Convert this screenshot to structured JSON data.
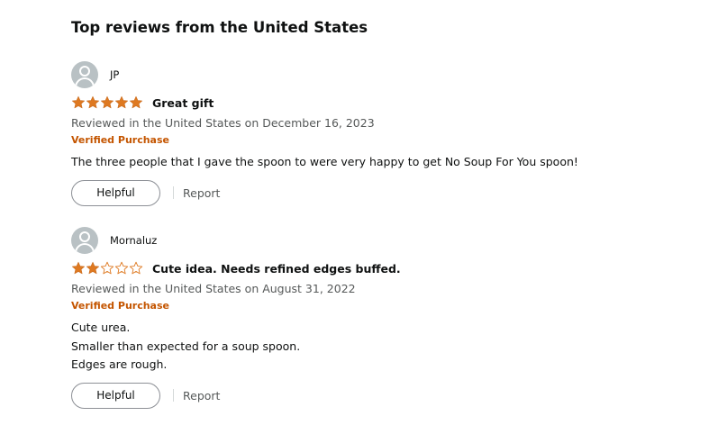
{
  "section_title": "Top reviews from the United States",
  "colors": {
    "star_fill": "#de7921",
    "star_empty_stroke": "#de7921",
    "verified": "#c45500",
    "avatar_bg": "#b9c1c4"
  },
  "reviews": [
    {
      "profile_name": "JP",
      "avatar_icon": "default-user-avatar-icon",
      "rating": 5,
      "rating_max": 5,
      "title": "Great gift",
      "date": "Reviewed in the United States on December 16, 2023",
      "verified": "Verified Purchase",
      "body_lines": [
        "The three people that I gave the spoon to were very happy to get No Soup For You spoon!"
      ],
      "helpful_label": "Helpful",
      "report_label": "Report"
    },
    {
      "profile_name": "Mornaluz",
      "avatar_icon": "default-user-avatar-icon",
      "rating": 2,
      "rating_max": 5,
      "title": "Cute idea. Needs refined edges buffed.",
      "date": "Reviewed in the United States on August 31, 2022",
      "verified": "Verified Purchase",
      "body_lines": [
        "Cute urea.",
        "Smaller than expected for a soup spoon.",
        "Edges are rough."
      ],
      "helpful_label": "Helpful",
      "report_label": "Report"
    }
  ]
}
